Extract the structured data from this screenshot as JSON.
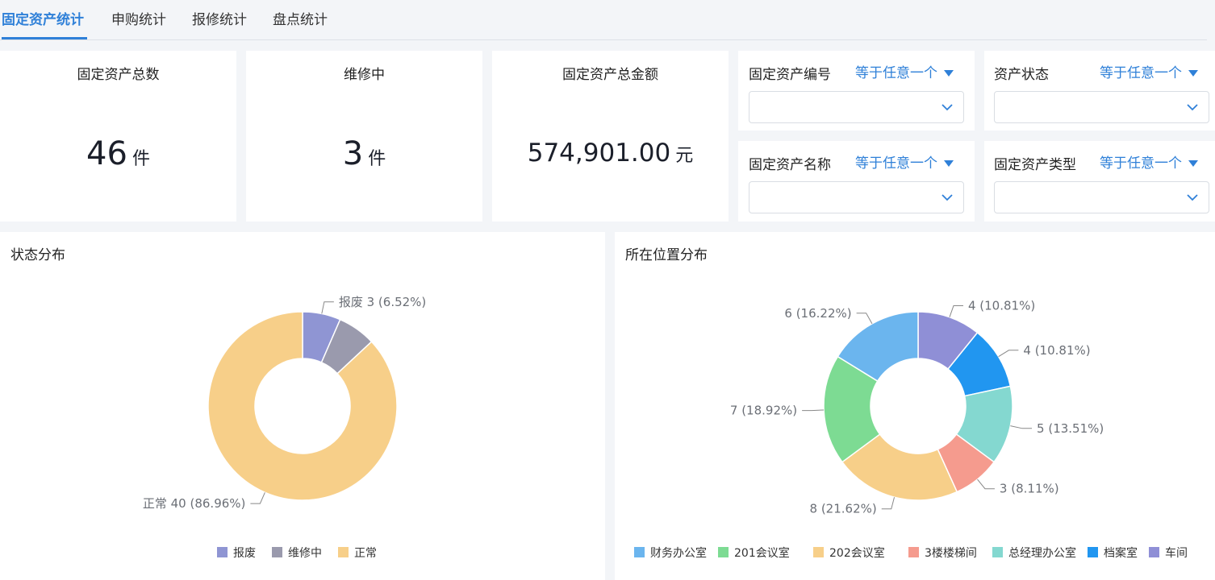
{
  "tabs": [
    {
      "label": "固定资产统计",
      "active": true
    },
    {
      "label": "申购统计",
      "active": false
    },
    {
      "label": "报修统计",
      "active": false
    },
    {
      "label": "盘点统计",
      "active": false
    }
  ],
  "stats": {
    "total": {
      "title": "固定资产总数",
      "value": "46",
      "unit": "件"
    },
    "repair": {
      "title": "维修中",
      "value": "3",
      "unit": "件"
    },
    "amount": {
      "title": "固定资产总金额",
      "value": "574,901.00",
      "unit": "元"
    }
  },
  "filters": {
    "code": {
      "label": "固定资产编号",
      "op": "等于任意一个",
      "value": ""
    },
    "status": {
      "label": "资产状态",
      "op": "等于任意一个",
      "value": ""
    },
    "name": {
      "label": "固定资产名称",
      "op": "等于任意一个",
      "value": ""
    },
    "type": {
      "label": "固定资产类型",
      "op": "等于任意一个",
      "value": ""
    }
  },
  "status_panel": {
    "title": "状态分布"
  },
  "location_panel": {
    "title": "所在位置分布"
  },
  "colors": {
    "accent": "#2f80d8",
    "scrap": "#8f95d3",
    "repairing": "#9a9aad",
    "normal": "#f7cf89",
    "caiwu": "#6bb5ee",
    "r201": "#7ddb93",
    "r202": "#f7cf89",
    "stair": "#f59b8e",
    "gm": "#84d8d0",
    "archive": "#2196f0",
    "workshop": "#8f8fd6"
  },
  "chart_data": [
    {
      "type": "pie",
      "title": "状态分布",
      "categories": [
        "报废",
        "维修中",
        "正常"
      ],
      "values": [
        3,
        3,
        40
      ],
      "labels": [
        "报废 3 (6.52%)",
        "",
        "正常 40 (86.96%)"
      ],
      "legend": [
        "报废",
        "维修中",
        "正常"
      ],
      "legend_position": "bottom",
      "colors": [
        "#8f95d3",
        "#9a9aad",
        "#f7cf89"
      ]
    },
    {
      "type": "pie",
      "title": "所在位置分布",
      "categories": [
        "车间",
        "档案室",
        "总经理办公室",
        "3楼楼梯间",
        "202会议室",
        "201会议室",
        "财务办公室"
      ],
      "values": [
        4,
        4,
        5,
        3,
        8,
        7,
        6
      ],
      "labels": [
        "4 (10.81%)",
        "4 (10.81%)",
        "5 (13.51%)",
        "3 (8.11%)",
        "8 (21.62%)",
        "7 (18.92%)",
        "6 (16.22%)"
      ],
      "legend": [
        "财务办公室",
        "201会议室",
        "202会议室",
        "3楼楼梯间",
        "总经理办公室",
        "档案室",
        "车间"
      ],
      "legend_position": "bottom",
      "colors": [
        "#8f8fd6",
        "#2196f0",
        "#84d8d0",
        "#f59b8e",
        "#f7cf89",
        "#7ddb93",
        "#6bb5ee"
      ]
    }
  ]
}
